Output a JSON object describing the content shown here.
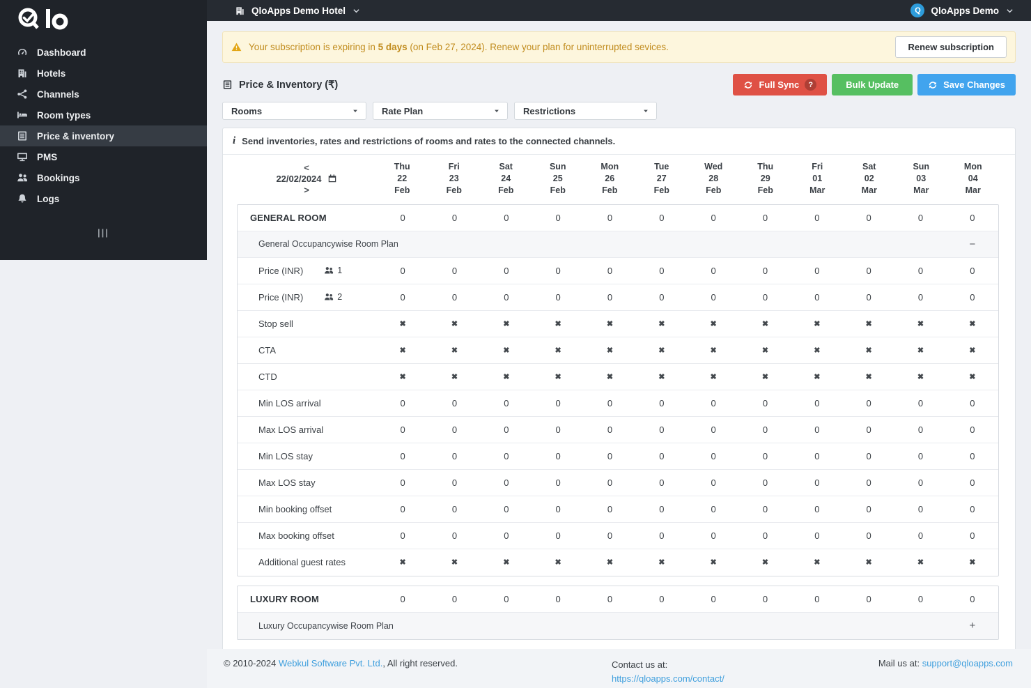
{
  "colors": {
    "sidebar-bg": "#1f2329",
    "topbar-bg": "#262b32",
    "page-bg": "#eef0f4",
    "sync-red": "#df5145",
    "bulk-green": "#56bf61",
    "save-blue": "#41a4ee",
    "link-blue": "#3f9fdd",
    "warning-bg": "#fdf6dd",
    "warning-text": "#c18c1e",
    "avatar-blue": "#2d9cdb"
  },
  "glyphs": {
    "cross": "✖",
    "info": "i"
  },
  "sidebar": {
    "items": [
      {
        "label": "Dashboard",
        "icon": "dashboard-icon",
        "active": false
      },
      {
        "label": "Hotels",
        "icon": "hotels-icon",
        "active": false
      },
      {
        "label": "Channels",
        "icon": "channels-icon",
        "active": false
      },
      {
        "label": "Room types",
        "icon": "room-types-icon",
        "active": false
      },
      {
        "label": "Price & inventory",
        "icon": "price-inventory-icon",
        "active": true
      },
      {
        "label": "PMS",
        "icon": "pms-icon",
        "active": false
      },
      {
        "label": "Bookings",
        "icon": "bookings-icon",
        "active": false
      },
      {
        "label": "Logs",
        "icon": "logs-icon",
        "active": false
      }
    ],
    "collapse_icon": "|||"
  },
  "header": {
    "hotel_selector": "QloApps Demo Hotel",
    "user_name": "QloApps Demo",
    "user_avatar_letter": "Q"
  },
  "banner": {
    "prefix": "Your subscription is expiring in",
    "bold_days": "5 days",
    "middle": "(on Feb 27, 2024). Renew your plan for uninterrupted sevices.",
    "button": "Renew subscription"
  },
  "toolbar": {
    "title": "Price & Inventory (₹)",
    "full_sync": "Full Sync",
    "help_badge": "?",
    "bulk_update": "Bulk Update",
    "save_changes": "Save Changes"
  },
  "filters": [
    {
      "label": "Rooms"
    },
    {
      "label": "Rate Plan"
    },
    {
      "label": "Restrictions"
    }
  ],
  "info_text": "Send inventories, rates and restrictions of rooms and rates to the connected channels.",
  "calendar": {
    "prev": "<",
    "date": "22/02/2024",
    "next": ">",
    "columns": [
      {
        "dow": "Thu",
        "day": "22",
        "mon": "Feb"
      },
      {
        "dow": "Fri",
        "day": "23",
        "mon": "Feb"
      },
      {
        "dow": "Sat",
        "day": "24",
        "mon": "Feb"
      },
      {
        "dow": "Sun",
        "day": "25",
        "mon": "Feb"
      },
      {
        "dow": "Mon",
        "day": "26",
        "mon": "Feb"
      },
      {
        "dow": "Tue",
        "day": "27",
        "mon": "Feb"
      },
      {
        "dow": "Wed",
        "day": "28",
        "mon": "Feb"
      },
      {
        "dow": "Thu",
        "day": "29",
        "mon": "Feb"
      },
      {
        "dow": "Fri",
        "day": "01",
        "mon": "Mar"
      },
      {
        "dow": "Sat",
        "day": "02",
        "mon": "Mar"
      },
      {
        "dow": "Sun",
        "day": "03",
        "mon": "Mar"
      },
      {
        "dow": "Mon",
        "day": "04",
        "mon": "Mar"
      }
    ]
  },
  "sections": [
    {
      "room": "GENERAL ROOM",
      "room_values": [
        "0",
        "0",
        "0",
        "0",
        "0",
        "0",
        "0",
        "0",
        "0",
        "0",
        "0",
        "0"
      ],
      "plan": "General Occupancywise Room Plan",
      "plan_toggle": "−",
      "rows": [
        {
          "label": "Price (INR)",
          "occupancy": "1",
          "type": "number",
          "values": [
            "0",
            "0",
            "0",
            "0",
            "0",
            "0",
            "0",
            "0",
            "0",
            "0",
            "0",
            "0"
          ]
        },
        {
          "label": "Price (INR)",
          "occupancy": "2",
          "type": "number",
          "values": [
            "0",
            "0",
            "0",
            "0",
            "0",
            "0",
            "0",
            "0",
            "0",
            "0",
            "0",
            "0"
          ]
        },
        {
          "label": "Stop sell",
          "type": "cross"
        },
        {
          "label": "CTA",
          "type": "cross"
        },
        {
          "label": "CTD",
          "type": "cross"
        },
        {
          "label": "Min LOS arrival",
          "type": "number",
          "values": [
            "0",
            "0",
            "0",
            "0",
            "0",
            "0",
            "0",
            "0",
            "0",
            "0",
            "0",
            "0"
          ]
        },
        {
          "label": "Max LOS arrival",
          "type": "number",
          "values": [
            "0",
            "0",
            "0",
            "0",
            "0",
            "0",
            "0",
            "0",
            "0",
            "0",
            "0",
            "0"
          ]
        },
        {
          "label": "Min LOS stay",
          "type": "number",
          "values": [
            "0",
            "0",
            "0",
            "0",
            "0",
            "0",
            "0",
            "0",
            "0",
            "0",
            "0",
            "0"
          ]
        },
        {
          "label": "Max LOS stay",
          "type": "number",
          "values": [
            "0",
            "0",
            "0",
            "0",
            "0",
            "0",
            "0",
            "0",
            "0",
            "0",
            "0",
            "0"
          ]
        },
        {
          "label": "Min booking offset",
          "type": "number",
          "values": [
            "0",
            "0",
            "0",
            "0",
            "0",
            "0",
            "0",
            "0",
            "0",
            "0",
            "0",
            "0"
          ]
        },
        {
          "label": "Max booking offset",
          "type": "number",
          "values": [
            "0",
            "0",
            "0",
            "0",
            "0",
            "0",
            "0",
            "0",
            "0",
            "0",
            "0",
            "0"
          ]
        },
        {
          "label": "Additional guest rates",
          "type": "cross"
        }
      ]
    },
    {
      "room": "LUXURY ROOM",
      "room_values": [
        "0",
        "0",
        "0",
        "0",
        "0",
        "0",
        "0",
        "0",
        "0",
        "0",
        "0",
        "0"
      ],
      "plan": "Luxury Occupancywise Room Plan",
      "plan_toggle": "+",
      "rows": []
    }
  ],
  "footer": {
    "copyright_prefix": "© 2010-2024",
    "copyright_link": "Webkul Software Pvt. Ltd.",
    "copyright_suffix": ", All right reserved.",
    "contact_label": "Contact us at:",
    "contact_link": "https://qloapps.com/contact/",
    "mail_label": "Mail us at:",
    "mail_link": "support@qloapps.com"
  }
}
